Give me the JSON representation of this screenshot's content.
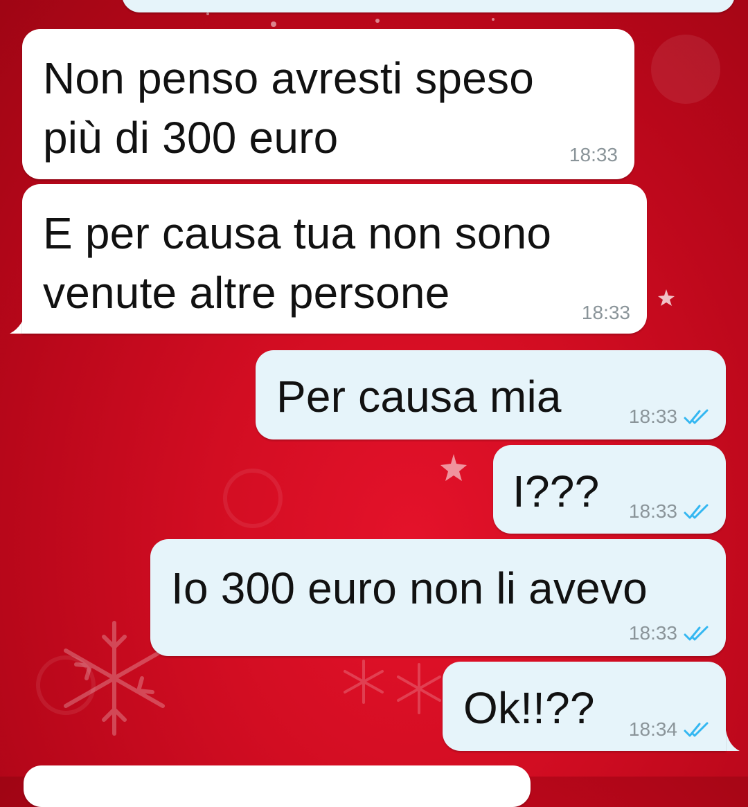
{
  "chat": {
    "messages": [
      {
        "direction": "incoming",
        "text_lines": [
          "Non penso avresti speso",
          "più di 300 euro"
        ],
        "time": "18:33"
      },
      {
        "direction": "incoming",
        "text_lines": [
          "E per causa tua non sono",
          "venute altre persone"
        ],
        "time": "18:33"
      },
      {
        "direction": "outgoing",
        "text": "Per causa mia",
        "time": "18:33",
        "status_icon": "double-check-read-icon"
      },
      {
        "direction": "outgoing",
        "text": "I???",
        "time": "18:33",
        "status_icon": "double-check-read-icon"
      },
      {
        "direction": "outgoing",
        "text": "Io 300 euro non li avevo",
        "time": "18:33",
        "status_icon": "double-check-read-icon"
      },
      {
        "direction": "outgoing",
        "text": "Ok!!??",
        "time": "18:34",
        "status_icon": "double-check-read-icon"
      }
    ]
  },
  "colors": {
    "wallpaper": "#d20d22",
    "incoming_bubble": "#ffffff",
    "outgoing_bubble": "#e6f4fa",
    "read_ticks": "#34b7f1",
    "timestamp": "#8a9499"
  }
}
